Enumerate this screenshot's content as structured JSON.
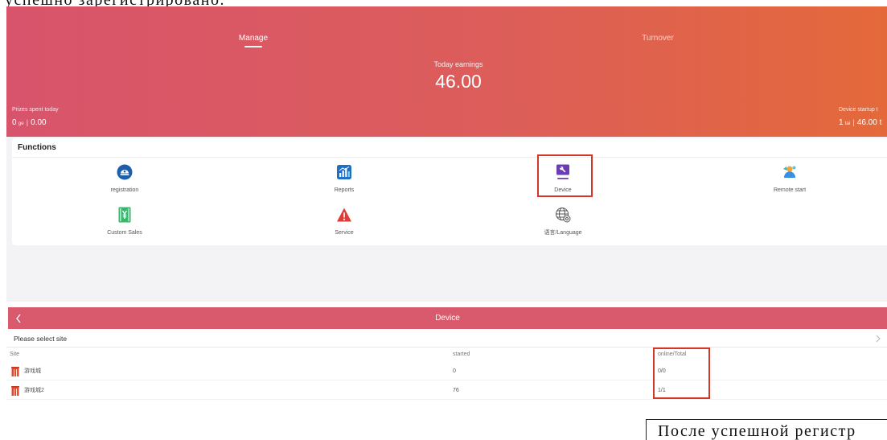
{
  "document": {
    "top_caption_cropped": "успешно зарегистрировано.",
    "bottom_caption_cropped": "После успешной регистр"
  },
  "manage_screen": {
    "tabs": [
      {
        "label": "Manage",
        "active": true
      },
      {
        "label": "Turnover",
        "active": false
      }
    ],
    "earnings": {
      "label": "Today earnings",
      "value": "46.00"
    },
    "prizes_today": {
      "label": "Prizes spent today",
      "count": "0",
      "unit": "ge",
      "separator": "|",
      "amount": "0.00"
    },
    "device_startup": {
      "label": "Device startup t",
      "count": "1",
      "unit": "tai",
      "separator": "|",
      "amount": "46.00 t"
    },
    "functions": {
      "title": "Functions",
      "items": [
        {
          "label": "registration",
          "icon": "registration-icon"
        },
        {
          "label": "Reports",
          "icon": "reports-icon"
        },
        {
          "label": "Device",
          "icon": "device-wrench-icon",
          "highlighted": true
        },
        {
          "label": "Remote start",
          "icon": "remote-start-icon"
        },
        {
          "label": "Custom Sales",
          "icon": "custom-sales-icon"
        },
        {
          "label": "Service",
          "icon": "service-warning-icon"
        },
        {
          "label": "语言/Language",
          "icon": "globe-language-icon"
        }
      ]
    }
  },
  "device_screen": {
    "title": "Device",
    "back_icon": "chevron-left-icon",
    "site_selector": {
      "label": "Please select site",
      "icon": "chevron-right-icon"
    },
    "columns": [
      "Site",
      "started",
      "online/Total"
    ],
    "rows": [
      {
        "site": "游戏城",
        "started": "0",
        "online_total": "0/0",
        "icon": "site-building-icon"
      },
      {
        "site": "游戏城2",
        "started": "76",
        "online_total": "1/1",
        "icon": "site-building-icon"
      }
    ],
    "highlighted_column_index": 2
  },
  "colors": {
    "header_gradient_start": "#d8546c",
    "header_gradient_mid": "#dc5d5a",
    "header_gradient_end": "#e4693a",
    "device_bar": "#d85a6c",
    "highlight_box": "#d3372c",
    "page_bg": "#f3f3f5"
  }
}
